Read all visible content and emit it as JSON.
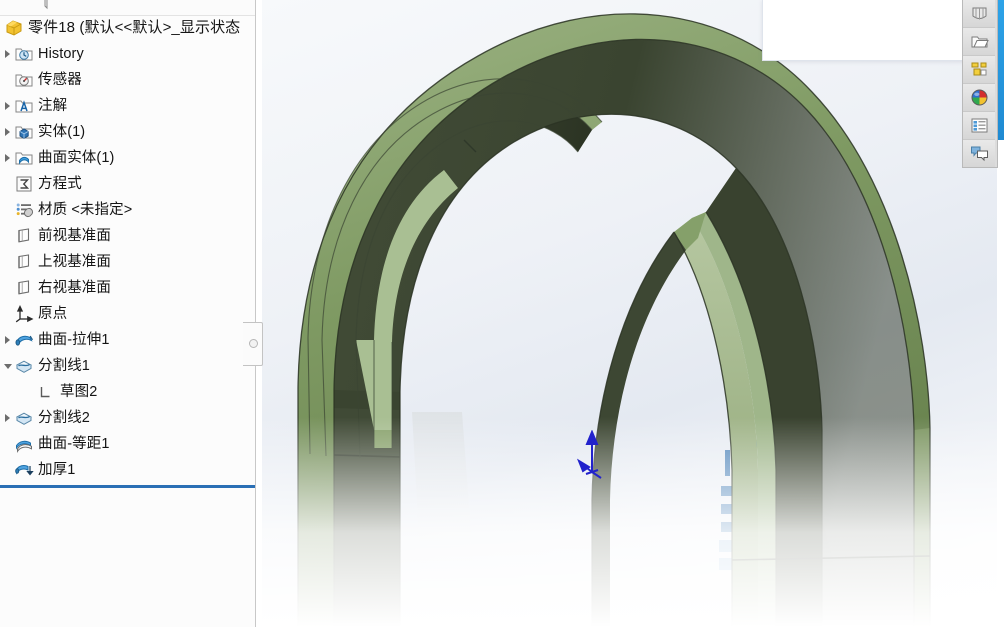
{
  "window": {
    "title": "零件18  (默认<<默认>_显示状态"
  },
  "tree": {
    "root_label": "零件18  (默认<<默认>_显示状态",
    "root_icon": "part-icon",
    "items": [
      {
        "label": "History",
        "icon": "history-folder-icon",
        "indent": 0,
        "arrow": "collapsed"
      },
      {
        "label": "传感器",
        "icon": "sensor-folder-icon",
        "indent": 0,
        "arrow": "none"
      },
      {
        "label": "注解",
        "icon": "annotations-folder-icon",
        "indent": 0,
        "arrow": "collapsed"
      },
      {
        "label": "实体(1)",
        "icon": "solid-bodies-folder-icon",
        "indent": 0,
        "arrow": "collapsed"
      },
      {
        "label": "曲面实体(1)",
        "icon": "surface-bodies-folder-icon",
        "indent": 0,
        "arrow": "collapsed"
      },
      {
        "label": "方程式",
        "icon": "equations-icon",
        "indent": 0,
        "arrow": "none"
      },
      {
        "label": "材质 <未指定>",
        "icon": "material-icon",
        "indent": 0,
        "arrow": "none"
      },
      {
        "label": "前视基准面",
        "icon": "plane-icon",
        "indent": 0,
        "arrow": "none"
      },
      {
        "label": "上视基准面",
        "icon": "plane-icon",
        "indent": 0,
        "arrow": "none"
      },
      {
        "label": "右视基准面",
        "icon": "plane-icon",
        "indent": 0,
        "arrow": "none"
      },
      {
        "label": "原点",
        "icon": "origin-icon",
        "indent": 0,
        "arrow": "none"
      },
      {
        "label": "曲面-拉伸1",
        "icon": "surface-extrude-icon",
        "indent": 0,
        "arrow": "collapsed"
      },
      {
        "label": "分割线1",
        "icon": "split-line-icon",
        "indent": 0,
        "arrow": "expanded"
      },
      {
        "label": "草图2",
        "icon": "sketch-icon",
        "indent": 1,
        "arrow": "none"
      },
      {
        "label": "分割线2",
        "icon": "split-line-icon",
        "indent": 0,
        "arrow": "collapsed"
      },
      {
        "label": "曲面-等距1",
        "icon": "surface-offset-icon",
        "indent": 0,
        "arrow": "none"
      },
      {
        "label": "加厚1",
        "icon": "thicken-icon",
        "indent": 0,
        "arrow": "none"
      }
    ],
    "rollback_bar": "rollback-bar"
  },
  "right_toolbar": {
    "buttons": [
      {
        "name": "view-orientation-icon"
      },
      {
        "name": "hidden-geometry-folder-icon"
      },
      {
        "name": "display-style-icon"
      },
      {
        "name": "appearance-sphere-icon"
      },
      {
        "name": "scene-list-icon"
      },
      {
        "name": "comments-icon"
      }
    ],
    "accent_color": "#2da3e8"
  },
  "viewport": {
    "background_top": "#f7f9fb",
    "background_bottom": "#ffffff",
    "model_name": "arched-bracket-model",
    "model_color_light": "#9db483",
    "model_color_mid": "#6d8a52",
    "model_color_dark": "#3f4a33",
    "model_color_shadow": "#2c3226",
    "origin_marker": "origin-triad",
    "origin_color": "#2222cc",
    "watermark": "blue-watermark"
  },
  "float_panel": {
    "name": "blank-popup-panel",
    "content": ""
  }
}
